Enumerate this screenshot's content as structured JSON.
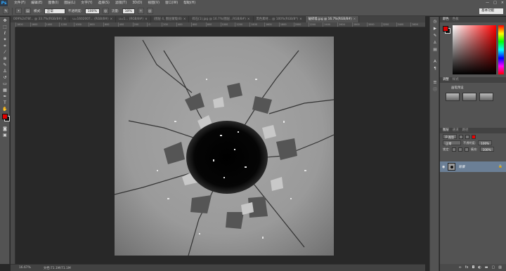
{
  "app": {
    "logo": "Ps"
  },
  "menu": [
    "文件(F)",
    "编辑(E)",
    "图像(I)",
    "图层(L)",
    "文字(Y)",
    "选择(S)",
    "滤镜(T)",
    "3D(D)",
    "视图(V)",
    "窗口(W)",
    "帮助(H)"
  ],
  "window_controls": [
    "—",
    "□",
    "×"
  ],
  "options": {
    "mode_label": "模式:",
    "mode_value": "正常",
    "opacity_label": "不透明度:",
    "opacity_value": "100%",
    "flow_label": "流量:",
    "flow_value": "10%",
    "workspace": "基本功能"
  },
  "tabs": [
    {
      "label": "009%2d78f... @ 33.7%(RGB/8#)",
      "active": false
    },
    {
      "label": "u=1602007... (RGB/8#)",
      "active": false
    },
    {
      "label": "u=1... (RGB/8#)",
      "active": false
    },
    {
      "label": "(图层 4, 图层蒙版/8)",
      "active": false
    },
    {
      "label": "碎石(1).jpg @ 16.7%(图层...RGB/8#)",
      "active": false
    },
    {
      "label": "黑色素材... @ 100%(RGB/8*)",
      "active": false
    },
    {
      "label": "破碎墙.jpg @ 16.7%(RGB/8#)",
      "active": true
    }
  ],
  "ruler_ticks": [
    "1800",
    "1600",
    "1400",
    "1200",
    "1000",
    "800",
    "600",
    "400",
    "200",
    "0",
    "200",
    "400",
    "600",
    "800",
    "1000",
    "1200",
    "1400",
    "1600",
    "1800",
    "2000",
    "2200",
    "2400",
    "2600",
    "2800",
    "3000",
    "3200",
    "3400",
    "3600"
  ],
  "status": {
    "zoom": "16.67%",
    "doc": "文档:71.1M/71.1M"
  },
  "panels": {
    "color_tabs": [
      "颜色",
      "色板"
    ],
    "adjust_tabs": [
      "调整",
      "样式"
    ],
    "adjust_sub": "画笔预设",
    "layers_tabs": [
      "图层",
      "通道",
      "路径"
    ],
    "layers_kind": "P 类型",
    "blend_mode": "正常",
    "opacity_label": "不透明度:",
    "opacity_value": "100%",
    "lock_label": "锁定:",
    "fill_label": "填充:",
    "fill_value": "100%",
    "layer_name": "背景",
    "lock_glyph": "🔒"
  },
  "colors": {
    "foreground": "#e00000",
    "background": "#111111",
    "accent": "#31a8ff"
  }
}
